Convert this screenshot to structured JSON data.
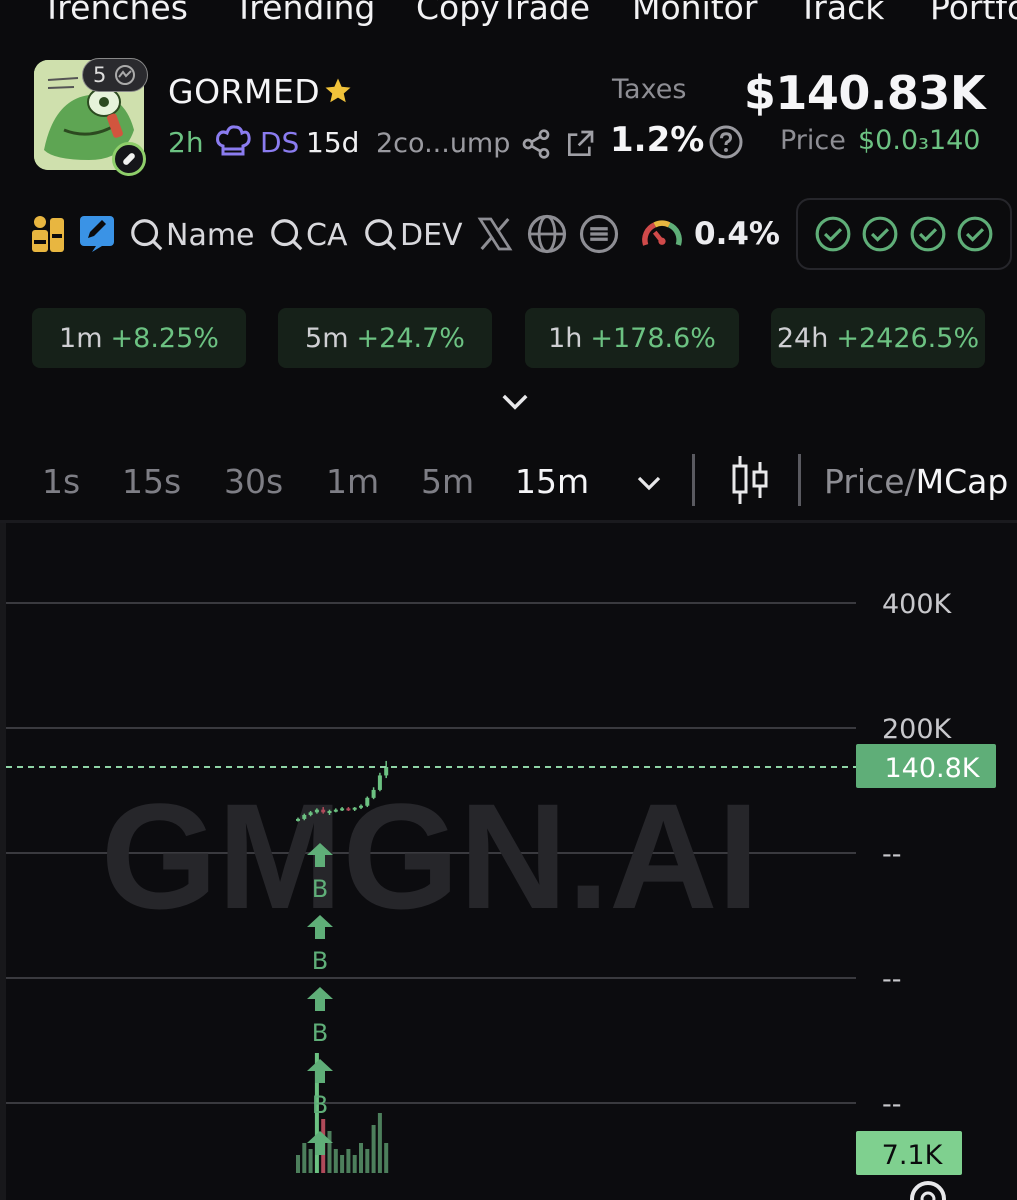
{
  "nav": {
    "items": [
      "Trenches",
      "Trending",
      "CopyTrade",
      "Monitor",
      "Track",
      "Portfo"
    ]
  },
  "token": {
    "holder_count": "5",
    "name": "GORMED",
    "age": "2h",
    "ds": "DS",
    "ds_age": "15d",
    "ca_short": "2co...ump"
  },
  "taxes": {
    "label": "Taxes",
    "value": "1.2%"
  },
  "market_cap": "$140.83K",
  "price": {
    "label": "Price",
    "value": "$0.0₃140"
  },
  "toolbar": {
    "search_name": "Name",
    "search_ca": "CA",
    "search_dev": "DEV",
    "risk_pct": "0.4%"
  },
  "changes": [
    {
      "period": "1m",
      "value": "+8.25%"
    },
    {
      "period": "5m",
      "value": "+24.7%"
    },
    {
      "period": "1h",
      "value": "+178.6%"
    },
    {
      "period": "24h",
      "value": "+2426.5%"
    }
  ],
  "intervals": {
    "items": [
      "1s",
      "15s",
      "30s",
      "1m",
      "5m",
      "15m"
    ],
    "active": "15m"
  },
  "chart_toggle": {
    "price": "Price/",
    "mcap": "MCap"
  },
  "chart_data": {
    "type": "candlestick",
    "y_tick_labels": [
      "400K",
      "200K",
      "--",
      "--",
      "--"
    ],
    "current_value_label": "140.8K",
    "volume_label": "7.1K",
    "watermark": "GMGN.AI",
    "trade_markers": [
      "B",
      "B",
      "B",
      "B",
      "B"
    ],
    "candles": [
      {
        "o": 60,
        "h": 64,
        "l": 58,
        "c": 62
      },
      {
        "o": 62,
        "h": 70,
        "l": 60,
        "c": 68
      },
      {
        "o": 68,
        "h": 74,
        "l": 66,
        "c": 72
      },
      {
        "o": 72,
        "h": 78,
        "l": 70,
        "c": 76
      },
      {
        "o": 76,
        "h": 80,
        "l": 70,
        "c": 72
      },
      {
        "o": 72,
        "h": 76,
        "l": 68,
        "c": 74
      },
      {
        "o": 74,
        "h": 78,
        "l": 72,
        "c": 76
      },
      {
        "o": 76,
        "h": 80,
        "l": 74,
        "c": 78
      },
      {
        "o": 78,
        "h": 80,
        "l": 74,
        "c": 76
      },
      {
        "o": 76,
        "h": 80,
        "l": 74,
        "c": 79
      },
      {
        "o": 79,
        "h": 84,
        "l": 77,
        "c": 82
      },
      {
        "o": 82,
        "h": 96,
        "l": 80,
        "c": 94
      },
      {
        "o": 94,
        "h": 110,
        "l": 92,
        "c": 106
      },
      {
        "o": 106,
        "h": 132,
        "l": 104,
        "c": 128
      },
      {
        "o": 128,
        "h": 150,
        "l": 124,
        "c": 140.8
      }
    ],
    "volumes": [
      3,
      5,
      4,
      20,
      9,
      7,
      4,
      3,
      4,
      3,
      5,
      4,
      8,
      10,
      5
    ]
  },
  "colors": {
    "background": "#0b0b0d",
    "up": "#6cc282",
    "down": "#b04a5a",
    "accent_purple": "#8b7cf0",
    "badge_green": "#5fae78"
  }
}
